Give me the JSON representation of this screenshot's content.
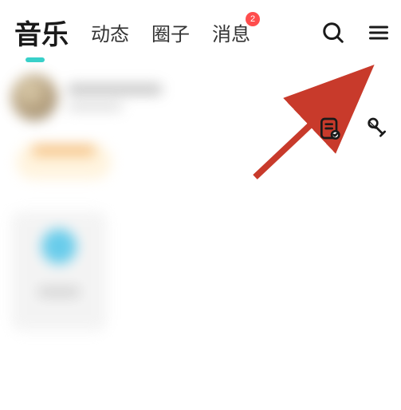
{
  "header": {
    "tabs": [
      {
        "label": "音乐",
        "active": true
      },
      {
        "label": "动态",
        "active": false
      },
      {
        "label": "圈子",
        "active": false
      },
      {
        "label": "消息",
        "active": false,
        "badge": "2"
      }
    ]
  },
  "colors": {
    "accent": "#38d0c9",
    "badge": "#ff4d4d",
    "arrow": "#c83a2b"
  }
}
